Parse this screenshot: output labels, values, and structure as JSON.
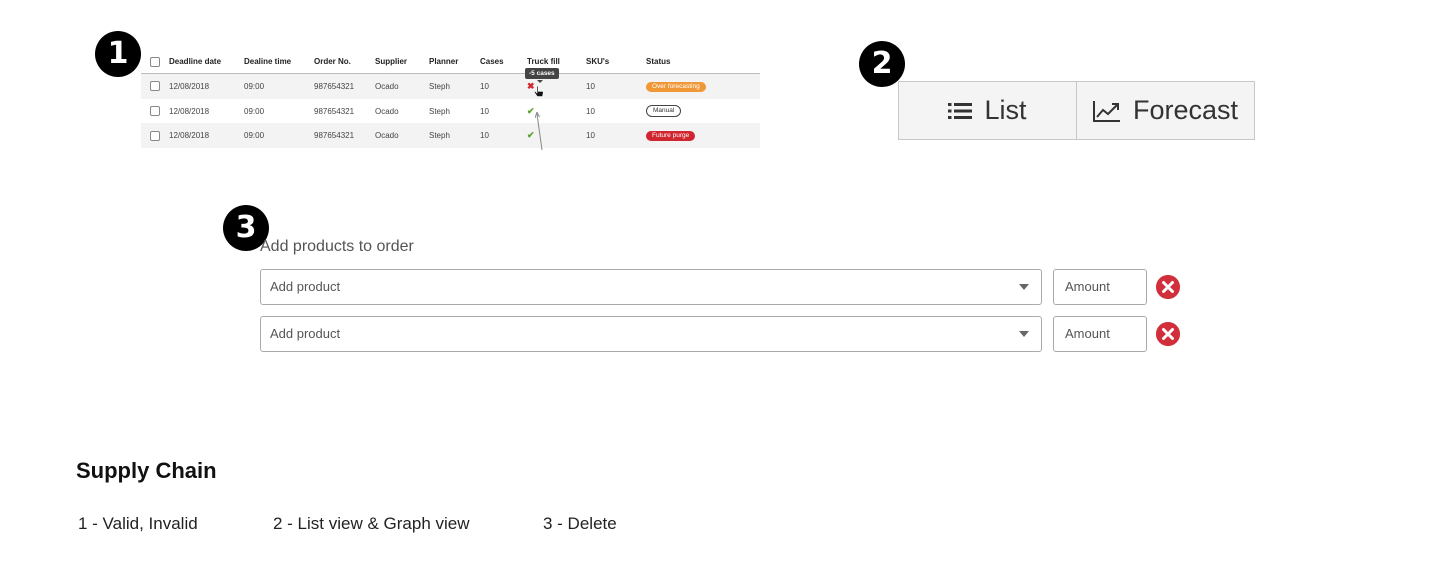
{
  "markers": [
    "1",
    "2",
    "3"
  ],
  "table": {
    "headers": [
      "Deadline date",
      "Dealine time",
      "Order No.",
      "Supplier",
      "Planner",
      "Cases",
      "Truck fill",
      "SKU's",
      "Status"
    ],
    "rows": [
      {
        "date": "12/08/2018",
        "time": "09:00",
        "order": "987654321",
        "supplier": "Ocado",
        "planner": "Steph",
        "cases": "10",
        "truck_fill": "✖",
        "skus": "10",
        "status": "Over forecasting"
      },
      {
        "date": "12/08/2018",
        "time": "09:00",
        "order": "987654321",
        "supplier": "Ocado",
        "planner": "Steph",
        "cases": "10",
        "truck_fill": "✔",
        "skus": "10",
        "status": "Manual"
      },
      {
        "date": "12/08/2018",
        "time": "09:00",
        "order": "987654321",
        "supplier": "Ocado",
        "planner": "Steph",
        "cases": "10",
        "truck_fill": "✔",
        "skus": "10",
        "status": "Future purge"
      }
    ],
    "tooltip": "-5 cases",
    "icons": {
      "invalid": "cross-icon",
      "valid": "check-icon",
      "cursor": "hand-cursor-icon"
    },
    "colors": {
      "over_forecasting": "#f09838",
      "future_purge": "#d0262f",
      "valid": "#5aa02c",
      "invalid": "#d0262f"
    }
  },
  "view_toggle": {
    "list_label": "List",
    "forecast_label": "Forecast",
    "icons": {
      "list": "list-icon",
      "forecast": "line-chart-icon"
    }
  },
  "add_products": {
    "title": "Add products to order",
    "rows": [
      {
        "product_placeholder": "Add product",
        "amount_placeholder": "Amount"
      },
      {
        "product_placeholder": "Add product",
        "amount_placeholder": "Amount"
      }
    ],
    "delete_icon": "delete-circle-icon",
    "delete_color": "#d12f3b"
  },
  "legend": {
    "title": "Supply Chain",
    "items": [
      "1 - Valid, Invalid",
      "2 - List view & Graph view",
      "3 - Delete"
    ]
  }
}
